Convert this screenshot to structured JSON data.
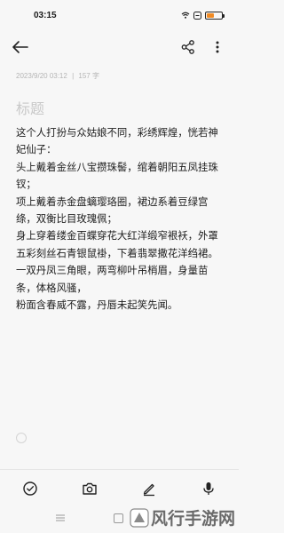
{
  "status": {
    "time": "03:15",
    "battery": "55"
  },
  "meta": {
    "timestamp": "2023/9/20 03:12",
    "separator": "|",
    "word_count": "157 字"
  },
  "note": {
    "title_placeholder": "标题",
    "paragraphs": [
      "这个人打扮与众姑娘不同，彩绣辉煌，恍若神妃仙子：",
      "头上戴着金丝八宝攒珠髻，绾着朝阳五凤挂珠钗；",
      "项上戴着赤金盘螭璎珞圈，裙边系着豆绿宫绦，双衡比目玫瑰佩；",
      "身上穿着缕金百蝶穿花大红洋缎窄裉袄，外罩五彩刻丝石青银鼠褂，下着翡翠撒花洋绉裙。",
      "一双丹凤三角眼，两弯柳叶吊梢眉，身量苗条，体格风骚，",
      "粉面含春威不露，丹唇未起笑先闻。"
    ]
  },
  "watermark": {
    "text": "风行手游网"
  },
  "colors": {
    "accent": "#f08a24",
    "icon": "#222222"
  }
}
